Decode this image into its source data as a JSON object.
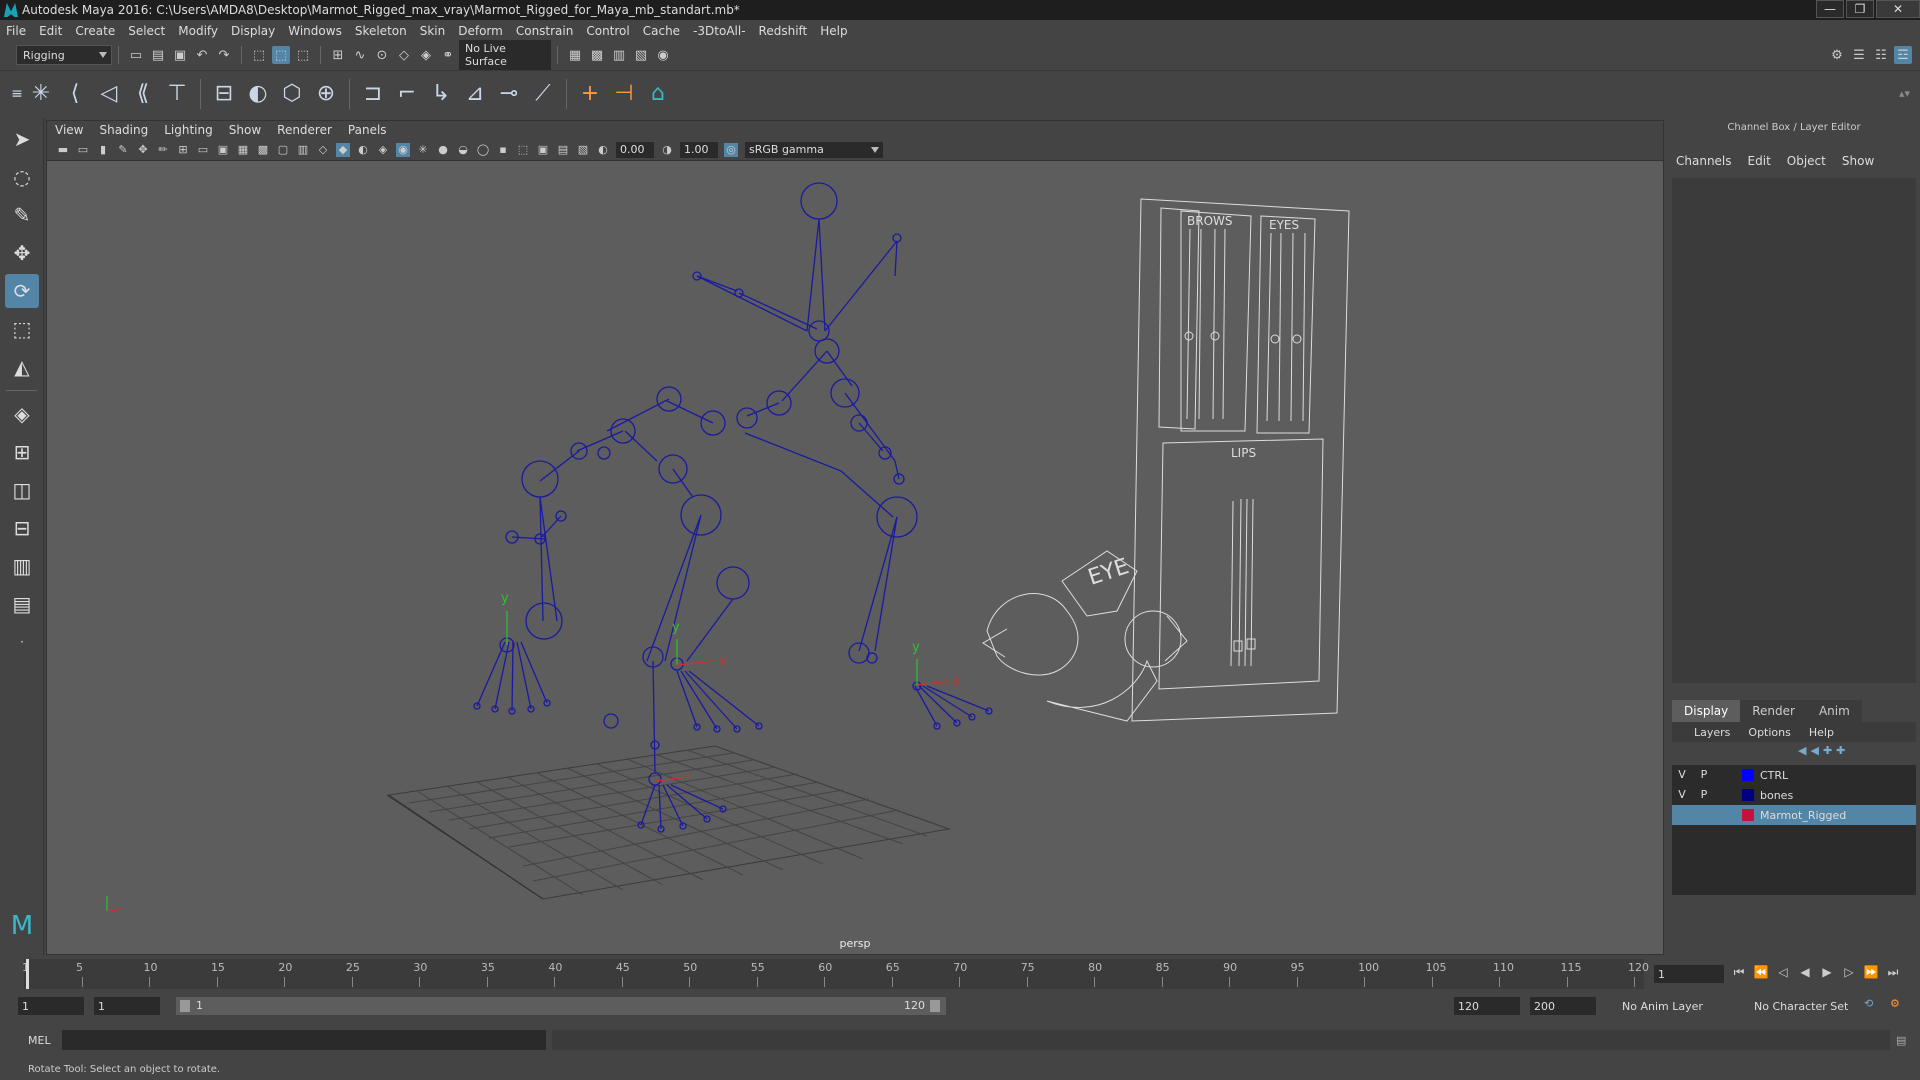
{
  "window": {
    "title": "Autodesk Maya 2016: C:\\Users\\AMDA8\\Desktop\\Marmot_Rigged_max_vray\\Marmot_Rigged_for_Maya_mb_standart.mb*",
    "min_glyph": "—",
    "max_glyph": "❐",
    "close_glyph": "✕"
  },
  "menubar": [
    "File",
    "Edit",
    "Create",
    "Select",
    "Modify",
    "Display",
    "Windows",
    "Skeleton",
    "Skin",
    "Deform",
    "Constrain",
    "Control",
    "Cache",
    "-3DtoAll-",
    "Redshift",
    "Help"
  ],
  "status_line": {
    "mode": "Rigging",
    "live_surface": "No Live Surface"
  },
  "viewport": {
    "menu": [
      "View",
      "Shading",
      "Lighting",
      "Show",
      "Renderer",
      "Panels"
    ],
    "exposure": "0.00",
    "gamma_value": "1.00",
    "color_space": "sRGB gamma",
    "camera_label": "persp",
    "axis_y": "y",
    "axis_x": "x",
    "ctrl_brows": "BROWS",
    "ctrl_eyes": "EYES",
    "ctrl_lips": "LIPS",
    "ctrl_eye": "EYE"
  },
  "right_panel": {
    "title": "Channel Box / Layer Editor",
    "channel_menu": [
      "Channels",
      "Edit",
      "Object",
      "Show"
    ],
    "layer_tabs": [
      "Display",
      "Render",
      "Anim"
    ],
    "layer_menu": [
      "Layers",
      "Options",
      "Help"
    ],
    "layers": [
      {
        "v": "V",
        "p": "P",
        "name": "CTRL",
        "color": "#0000ff",
        "selected": false
      },
      {
        "v": "V",
        "p": "P",
        "name": "bones",
        "color": "#000080",
        "selected": false
      },
      {
        "v": "",
        "p": "",
        "name": "Marmot_Rigged",
        "color": "#c0143c",
        "selected": true
      }
    ]
  },
  "timeline": {
    "ticks": [
      "1",
      "5",
      "10",
      "15",
      "20",
      "25",
      "30",
      "35",
      "40",
      "45",
      "50",
      "55",
      "60",
      "65",
      "70",
      "75",
      "80",
      "85",
      "90",
      "95",
      "100",
      "105",
      "110",
      "115",
      "120"
    ],
    "current_frame": "1"
  },
  "range": {
    "start": "1",
    "playback_start": "1",
    "slider_start": "1",
    "slider_end": "120",
    "playback_end": "120",
    "end": "200",
    "anim_layer": "No Anim Layer",
    "character_set": "No Character Set"
  },
  "command_line": {
    "language": "MEL"
  },
  "help_line": {
    "text": "Rotate Tool: Select an object to rotate."
  }
}
